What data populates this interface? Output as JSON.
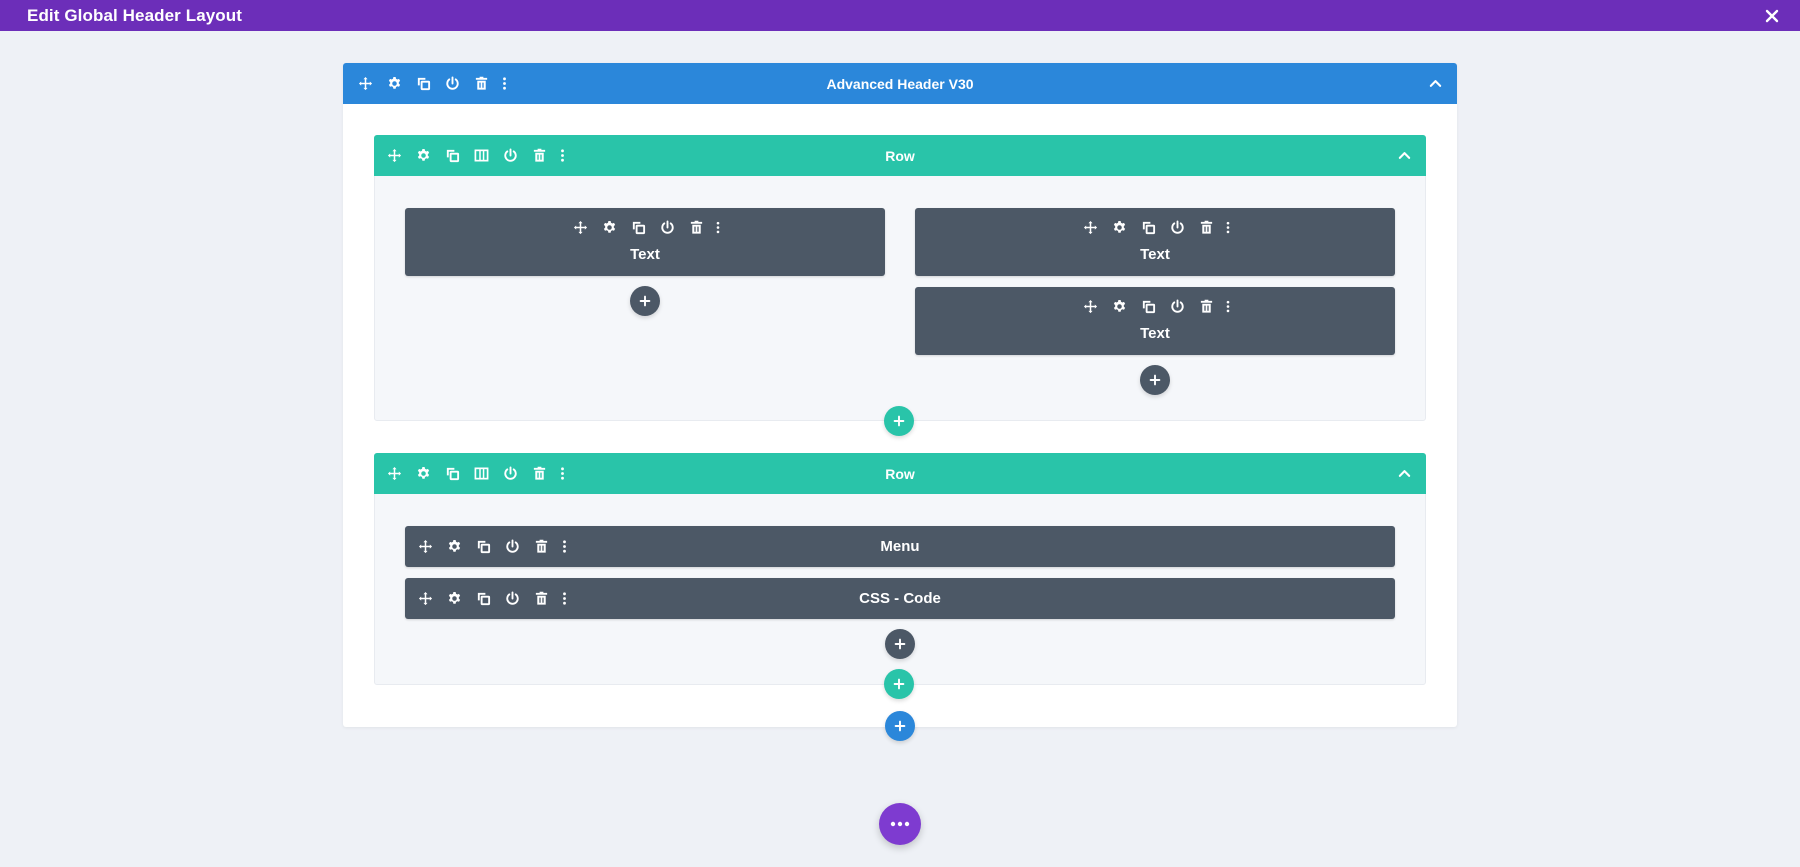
{
  "window": {
    "title": "Edit Global Header Layout",
    "close_icon": "close-icon"
  },
  "section": {
    "title": "Advanced Header V30",
    "color": "#2b87da"
  },
  "rows": [
    {
      "title": "Row",
      "columns": [
        {
          "modules": [
            {
              "label": "Text"
            }
          ]
        },
        {
          "modules": [
            {
              "label": "Text"
            },
            {
              "label": "Text"
            }
          ]
        }
      ]
    },
    {
      "title": "Row",
      "modules": [
        {
          "label": "Menu"
        },
        {
          "label": "CSS - Code"
        }
      ]
    }
  ],
  "colors": {
    "topbar": "#6c2eb9",
    "section": "#2b87da",
    "row": "#29c4a9",
    "module": "#4c5866",
    "fab": "#7e3bd0"
  },
  "icons": [
    "move-icon",
    "gear-icon",
    "duplicate-icon",
    "columns-icon",
    "power-icon",
    "trash-icon",
    "more-icon",
    "chevron-up-icon",
    "plus-icon",
    "ellipsis-icon"
  ]
}
